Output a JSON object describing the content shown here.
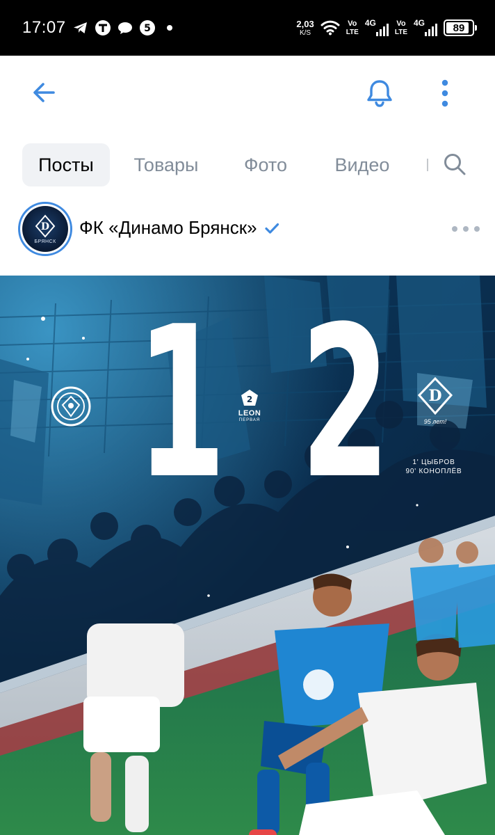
{
  "status_bar": {
    "time": "17:07",
    "notifications": [
      "telegram-icon",
      "tinkoff-icon",
      "message-icon",
      "five-icon",
      "dot-icon"
    ],
    "speed_value": "2,03",
    "speed_unit": "K/S",
    "sim1_label_top": "Vo",
    "sim1_label_bottom": "LTE",
    "sim1_network": "4G",
    "sim2_label_top": "Vo",
    "sim2_label_bottom": "LTE",
    "sim2_network": "4G",
    "battery": "89",
    "battery_level": 0.89
  },
  "header": {
    "back_icon": "arrow-left-icon",
    "bell_icon": "bell-icon",
    "more_icon": "more-vertical-icon",
    "accent_color": "#3f8ae0"
  },
  "tabs": [
    {
      "label": "Посты",
      "active": true
    },
    {
      "label": "Товары",
      "active": false
    },
    {
      "label": "Фото",
      "active": false
    },
    {
      "label": "Видео",
      "active": false
    }
  ],
  "post": {
    "author": "ФК «Динамо Брянск»",
    "verified": true,
    "avatar_caption": "БРЯНСК",
    "image": {
      "score_home": "1",
      "score_away": "2",
      "league_text": "LEON",
      "league_sub": "ПЕРВАЯ",
      "league_number": "2",
      "away_years": "95 лет!",
      "scorer_1": "1' ЦЫБРОВ",
      "scorer_2": "90' КОНОПЛЁВ"
    }
  }
}
